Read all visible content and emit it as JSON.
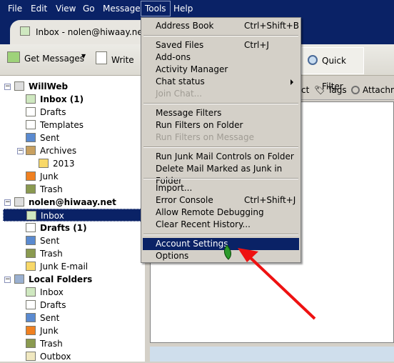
{
  "menubar": [
    "File",
    "Edit",
    "View",
    "Go",
    "Message",
    "Tools",
    "Help"
  ],
  "tab": {
    "title": "Inbox - nolen@hiwaay.net"
  },
  "toolbar": {
    "get_messages": "Get Messages",
    "write": "Write",
    "quick_filter": "Quick Filter"
  },
  "filterbar": {
    "contact_partial": "ct",
    "tags": "Tags",
    "attachments_partial": "Attachme"
  },
  "folders": [
    {
      "label": "WillWeb",
      "level": 0,
      "bold": true,
      "icon": "account-icon"
    },
    {
      "label": "Inbox (1)",
      "level": 1,
      "bold": true,
      "icon": "inbox-icon"
    },
    {
      "label": "Drafts",
      "level": 1,
      "icon": "drafts-icon"
    },
    {
      "label": "Templates",
      "level": 1,
      "icon": "templates-icon"
    },
    {
      "label": "Sent",
      "level": 1,
      "icon": "sent-icon"
    },
    {
      "label": "Archives",
      "level": 1,
      "icon": "archives-icon",
      "expander": true
    },
    {
      "label": "2013",
      "level": 2,
      "icon": "folder-icon"
    },
    {
      "label": "Junk",
      "level": 1,
      "icon": "junk-icon"
    },
    {
      "label": "Trash",
      "level": 1,
      "icon": "trash-icon"
    },
    {
      "label": "nolen@hiwaay.net",
      "level": 0,
      "bold": true,
      "icon": "account-icon"
    },
    {
      "label": "Inbox",
      "level": 1,
      "selected": true,
      "icon": "inbox-icon"
    },
    {
      "label": "Drafts (1)",
      "level": 1,
      "bold": true,
      "icon": "drafts-icon"
    },
    {
      "label": "Sent",
      "level": 1,
      "icon": "sent-icon"
    },
    {
      "label": "Trash",
      "level": 1,
      "icon": "trash-icon"
    },
    {
      "label": "Junk E-mail",
      "level": 1,
      "icon": "folder-icon"
    },
    {
      "label": "Local Folders",
      "level": 0,
      "bold": true,
      "icon": "computer-icon"
    },
    {
      "label": "Inbox",
      "level": 1,
      "icon": "inbox-icon"
    },
    {
      "label": "Drafts",
      "level": 1,
      "icon": "drafts-icon"
    },
    {
      "label": "Sent",
      "level": 1,
      "icon": "sent-icon"
    },
    {
      "label": "Junk",
      "level": 1,
      "icon": "junk-icon"
    },
    {
      "label": "Trash",
      "level": 1,
      "icon": "trash-icon"
    },
    {
      "label": "Outbox",
      "level": 1,
      "icon": "outbox-icon"
    }
  ],
  "tools_menu": [
    [
      {
        "label": "Address Book",
        "shortcut": "Ctrl+Shift+B"
      }
    ],
    [
      {
        "label": "Saved Files",
        "shortcut": "Ctrl+J"
      },
      {
        "label": "Add-ons"
      },
      {
        "label": "Activity Manager"
      },
      {
        "label": "Chat status",
        "submenu": true
      },
      {
        "label": "Join Chat...",
        "disabled": true
      }
    ],
    [
      {
        "label": "Message Filters"
      },
      {
        "label": "Run Filters on Folder"
      },
      {
        "label": "Run Filters on Message",
        "disabled": true
      }
    ],
    [
      {
        "label": "Run Junk Mail Controls on Folder"
      },
      {
        "label": "Delete Mail Marked as Junk in Folder"
      }
    ],
    [
      {
        "label": "Import..."
      },
      {
        "label": "Error Console",
        "shortcut": "Ctrl+Shift+J"
      },
      {
        "label": "Allow Remote Debugging"
      },
      {
        "label": "Clear Recent History..."
      }
    ],
    [
      {
        "label": "Account Settings",
        "highlighted": true
      },
      {
        "label": "Options"
      }
    ]
  ],
  "colors": {
    "menubar": "#0a2266",
    "highlight": "#0a2266",
    "arrow": "#ee1111"
  }
}
